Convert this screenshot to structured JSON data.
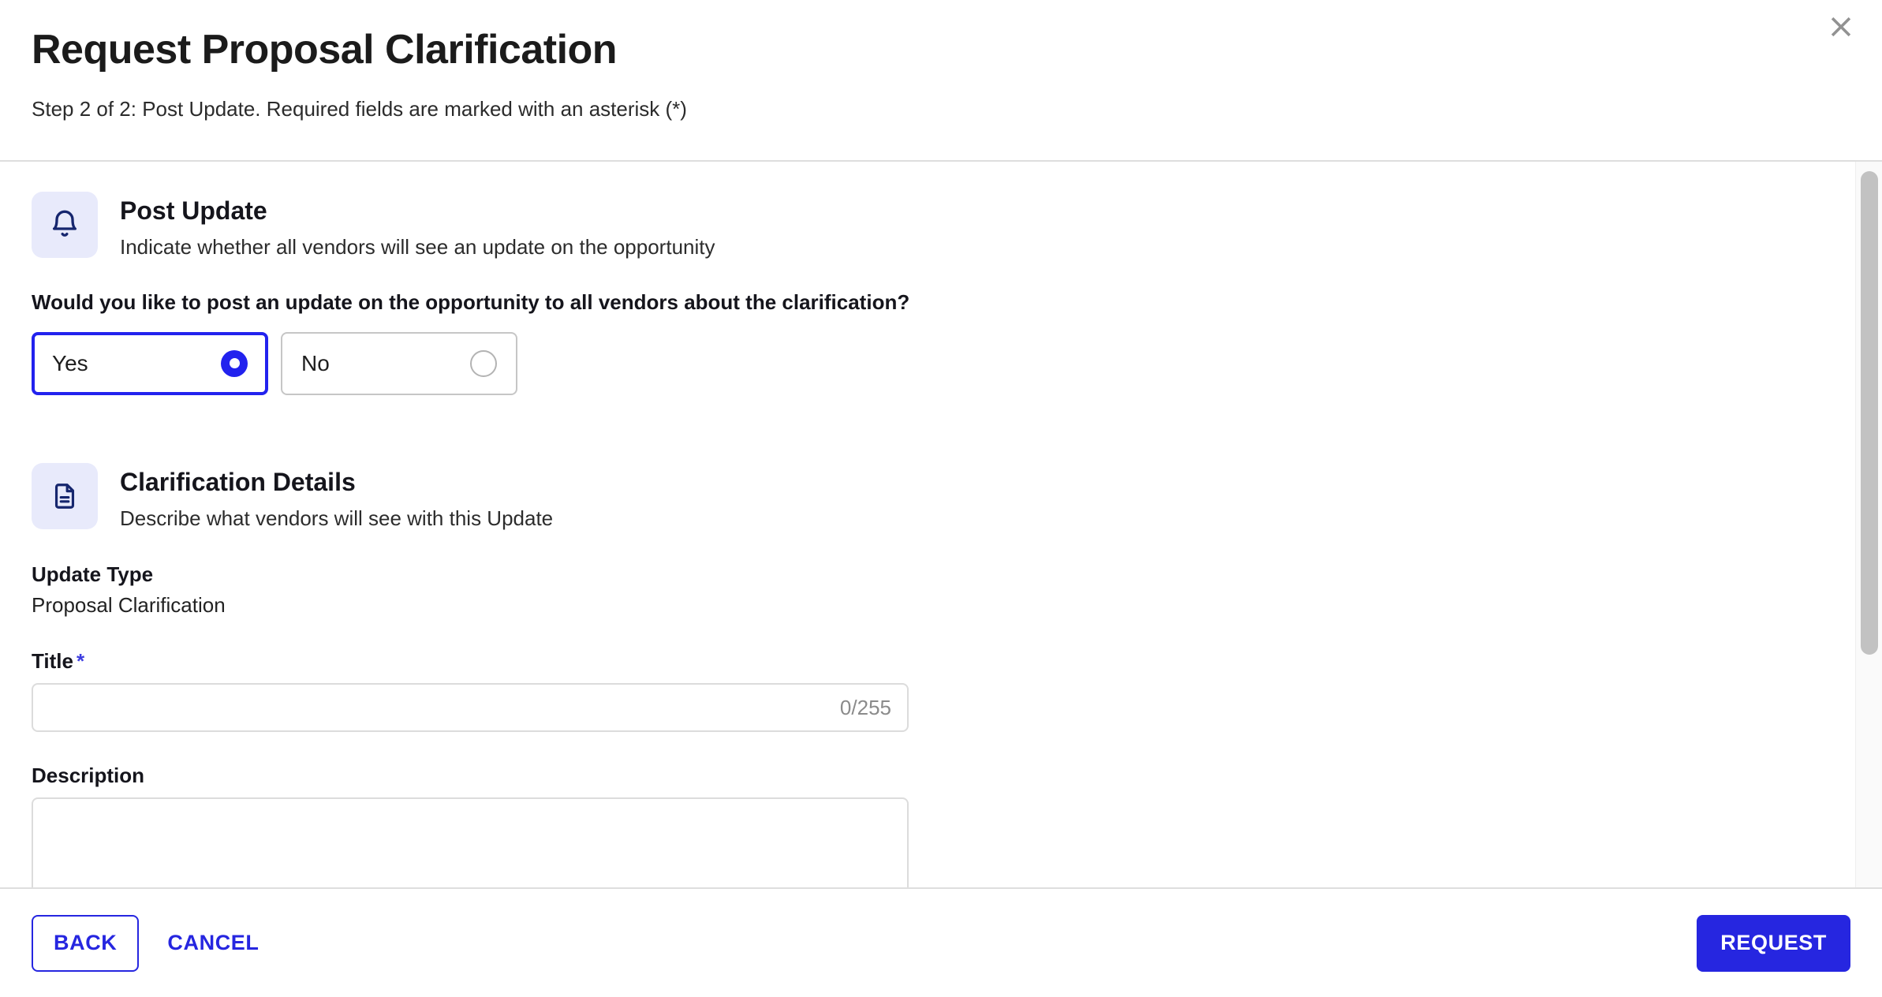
{
  "dialog": {
    "title": "Request Proposal Clarification",
    "subtitle": "Step 2 of 2: Post Update. Required fields are marked with an asterisk (*)",
    "close_icon": "close-icon"
  },
  "sections": [
    {
      "icon": "bell-icon",
      "title": "Post Update",
      "description": "Indicate whether all vendors will see an update on the opportunity",
      "question": "Would you like to post an update on the opportunity to all vendors about the clarification?",
      "options": [
        {
          "label": "Yes",
          "selected": true
        },
        {
          "label": "No",
          "selected": false
        }
      ]
    },
    {
      "icon": "document-icon",
      "title": "Clarification Details",
      "description": "Describe what vendors will see with this Update"
    }
  ],
  "form": {
    "update_type_label": "Update Type",
    "update_type_value": "Proposal Clarification",
    "title_label": "Title",
    "title_required_mark": "*",
    "title_value": "",
    "title_counter": "0/255",
    "description_label": "Description",
    "description_value": ""
  },
  "footer": {
    "back_label": "BACK",
    "cancel_label": "CANCEL",
    "request_label": "REQUEST"
  },
  "colors": {
    "accent_blue": "#2626e0",
    "selected_border": "#2222ee",
    "icon_navy": "#16266e",
    "icon_bg": "#e8eafb",
    "required_star": "#3d3de0",
    "muted_text": "#8b8b8b"
  }
}
